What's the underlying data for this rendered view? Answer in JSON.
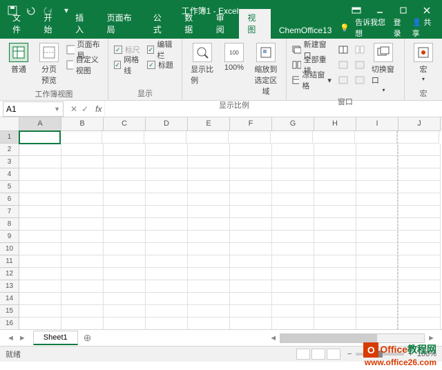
{
  "titlebar": {
    "title": "工作簿1 - Excel"
  },
  "tabs": {
    "items": [
      "文件",
      "开始",
      "插入",
      "页面布局",
      "公式",
      "数据",
      "审阅",
      "视图",
      "ChemOffice13"
    ],
    "active": "视图",
    "tell_me": "告诉我您想",
    "signin": "登录",
    "share": "共享"
  },
  "ribbon": {
    "group_views": {
      "label": "工作簿视图",
      "normal": "普通",
      "page_break": "分页\n预览",
      "page_layout": "页面布局",
      "custom_views": "自定义视图"
    },
    "group_show": {
      "label": "显示",
      "ruler": "标尺",
      "formula_bar": "编辑栏",
      "gridlines": "网格线",
      "headings": "标题"
    },
    "group_zoom": {
      "label": "显示比例",
      "zoom": "显示比例",
      "hundred": "100%",
      "to_selection": "缩放到\n选定区域"
    },
    "group_window": {
      "label": "窗口",
      "new_window": "新建窗口",
      "arrange_all": "全部重排",
      "freeze": "冻结窗格",
      "switch": "切换窗口"
    },
    "group_macros": {
      "label": "宏",
      "macros": "宏"
    }
  },
  "namebox": {
    "value": "A1",
    "fx": "fx"
  },
  "grid": {
    "columns": [
      "A",
      "B",
      "C",
      "D",
      "E",
      "F",
      "G",
      "H",
      "I",
      "J"
    ],
    "rows": [
      "1",
      "2",
      "3",
      "4",
      "5",
      "6",
      "7",
      "8",
      "9",
      "10",
      "11",
      "12",
      "13",
      "14",
      "15",
      "16"
    ],
    "active": "A1"
  },
  "sheetbar": {
    "sheet": "Sheet1"
  },
  "statusbar": {
    "ready": "就绪",
    "zoom": "100%"
  },
  "watermark": {
    "brand": "Office",
    "suffix": "教程网",
    "url": "www.office26.com"
  }
}
